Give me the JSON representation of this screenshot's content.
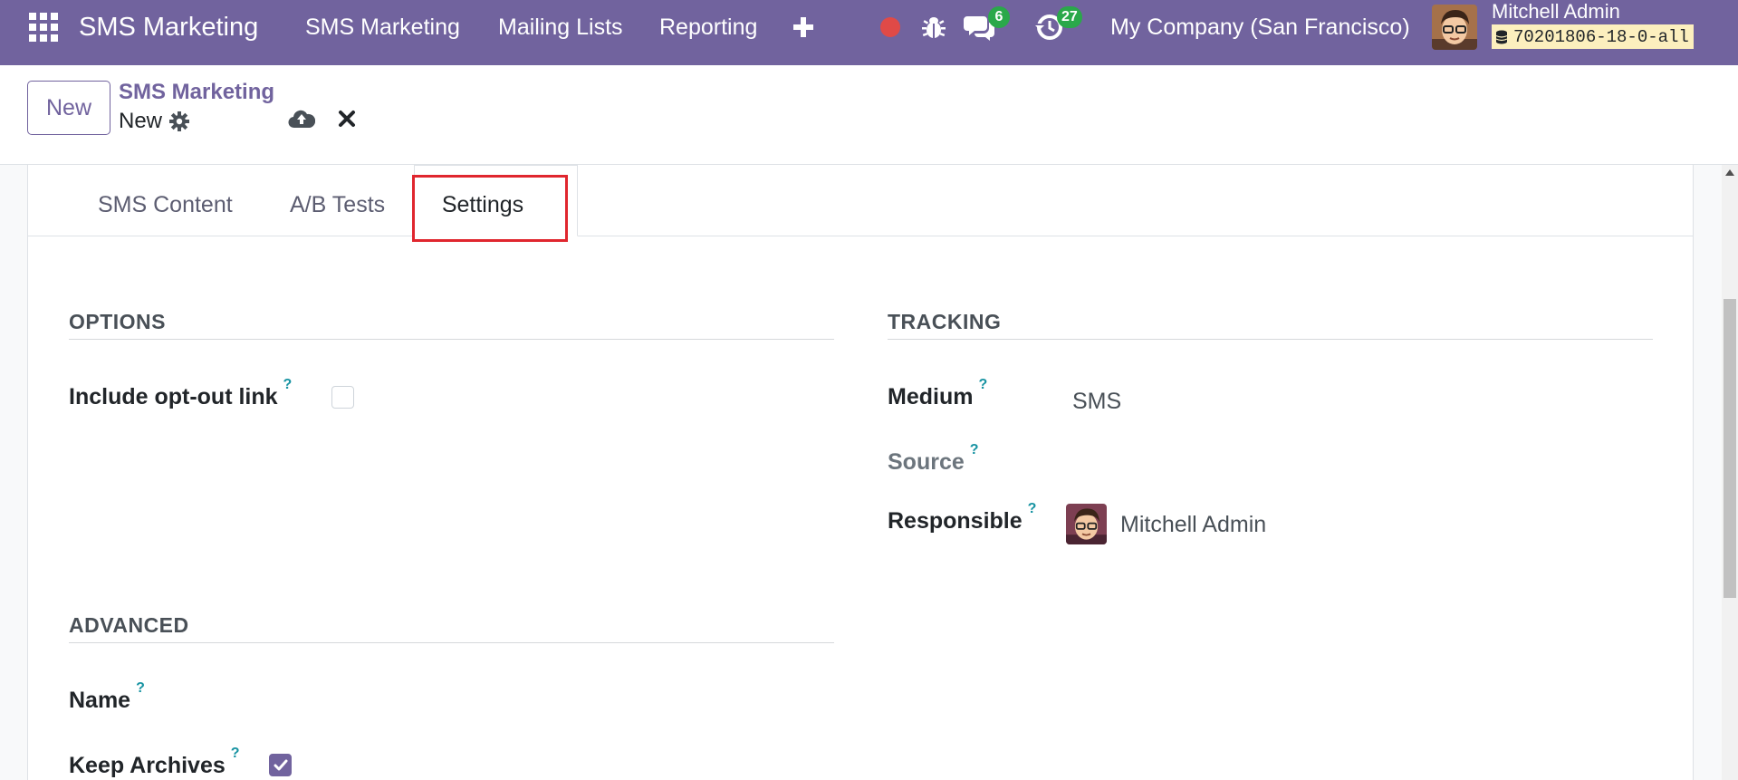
{
  "navbar": {
    "brand": "SMS Marketing",
    "menu": [
      "SMS Marketing",
      "Mailing Lists",
      "Reporting"
    ],
    "messages_count": "6",
    "activities_count": "27",
    "company": "My Company (San Francisco)",
    "user_name": "Mitchell Admin",
    "database": "70201806-18-0-all",
    "color": "#71639e"
  },
  "control_panel": {
    "new_label": "New",
    "breadcrumb_parent": "SMS Marketing",
    "breadcrumb_current": "New"
  },
  "tabs": {
    "items": [
      "SMS Content",
      "A/B Tests",
      "Settings"
    ],
    "active": "Settings"
  },
  "options": {
    "title": "OPTIONS",
    "opt_out_label": "Include opt-out link",
    "opt_out_checked": false
  },
  "tracking": {
    "title": "TRACKING",
    "medium_label": "Medium",
    "medium_value": "SMS",
    "source_label": "Source",
    "responsible_label": "Responsible",
    "responsible_value": "Mitchell Admin"
  },
  "advanced": {
    "title": "ADVANCED",
    "name_label": "Name",
    "keep_archives_label": "Keep Archives",
    "keep_archives_checked": true
  },
  "help_mark": "?",
  "colors": {
    "highlight": "#e0262e",
    "badge": "#2aa84a",
    "record": "#e04a47"
  }
}
